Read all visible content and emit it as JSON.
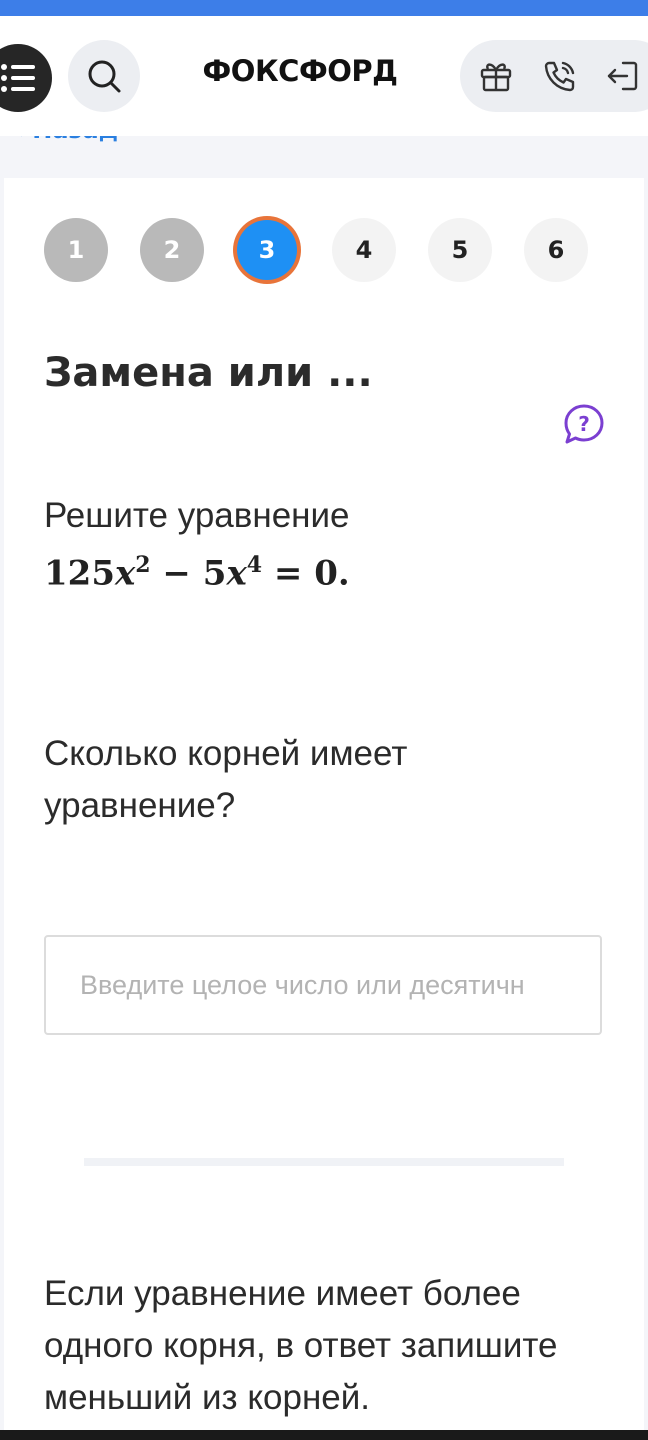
{
  "header": {
    "logo": "ФОКСФОРД",
    "back_label": "‹ Назад"
  },
  "steps": [
    {
      "label": "1",
      "state": "done"
    },
    {
      "label": "2",
      "state": "done"
    },
    {
      "label": "3",
      "state": "active"
    },
    {
      "label": "4",
      "state": "todo"
    },
    {
      "label": "5",
      "state": "todo"
    },
    {
      "label": "6",
      "state": "todo"
    }
  ],
  "task": {
    "title": "Замена или ...",
    "prompt": "Решите уравнение",
    "equation": {
      "a": "125",
      "var": "x",
      "p1": "2",
      "minus": "−",
      "b": "5",
      "p2": "4",
      "rhs": "= 0."
    },
    "question": "Сколько корней имеет уравнение?",
    "answer_placeholder": "Введите целое число или десятичн",
    "answer_value": "",
    "note": "Если уравнение имеет более одного корня, в ответ запишите меньший из корней."
  },
  "colors": {
    "accent_blue": "#1e90f4",
    "active_ring": "#e8743a",
    "link_blue": "#2a7fe0",
    "help_purple": "#7b3fd1",
    "top_bar": "#3d7ee8"
  },
  "icons": [
    "menu-icon",
    "search-icon",
    "gift-icon",
    "phone-icon",
    "login-icon",
    "help-chat-icon"
  ]
}
